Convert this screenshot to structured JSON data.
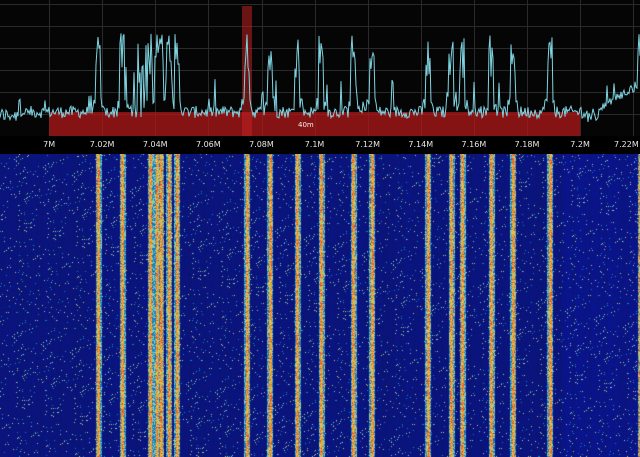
{
  "scale": {
    "unit_suffix": "M",
    "ticks": [
      {
        "value": 7.0,
        "label": "7M"
      },
      {
        "value": 7.02,
        "label": "7.02M"
      },
      {
        "value": 7.04,
        "label": "7.04M"
      },
      {
        "value": 7.06,
        "label": "7.06M"
      },
      {
        "value": 7.08,
        "label": "7.08M"
      },
      {
        "value": 7.1,
        "label": "7.1M"
      },
      {
        "value": 7.12,
        "label": "7.12M"
      },
      {
        "value": 7.14,
        "label": "7.14M"
      },
      {
        "value": 7.16,
        "label": "7.16M"
      },
      {
        "value": 7.18,
        "label": "7.18M"
      },
      {
        "value": 7.2,
        "label": "7.2M"
      },
      {
        "value": 7.22,
        "label": "7.22M"
      }
    ],
    "visible_range_mhz": [
      6.9815,
      7.2225
    ]
  },
  "band": {
    "label": "40m",
    "start_mhz": 7.0,
    "end_mhz": 7.2,
    "color": "#b01818"
  },
  "selection": {
    "center_mhz": 7.0745,
    "color": "#c02020"
  },
  "colors": {
    "spectrum_trace": "#7fd3e0",
    "grid": "#2a2a2a",
    "waterfall_background": "#0a1a6e"
  },
  "signals_mhz": [
    7.0185,
    7.0275,
    7.038,
    7.0405,
    7.042,
    7.045,
    7.048,
    7.0745,
    7.083,
    7.0935,
    7.1025,
    7.1145,
    7.1215,
    7.1425,
    7.1515,
    7.1555,
    7.1665,
    7.1745,
    7.1885,
    7.2225
  ]
}
